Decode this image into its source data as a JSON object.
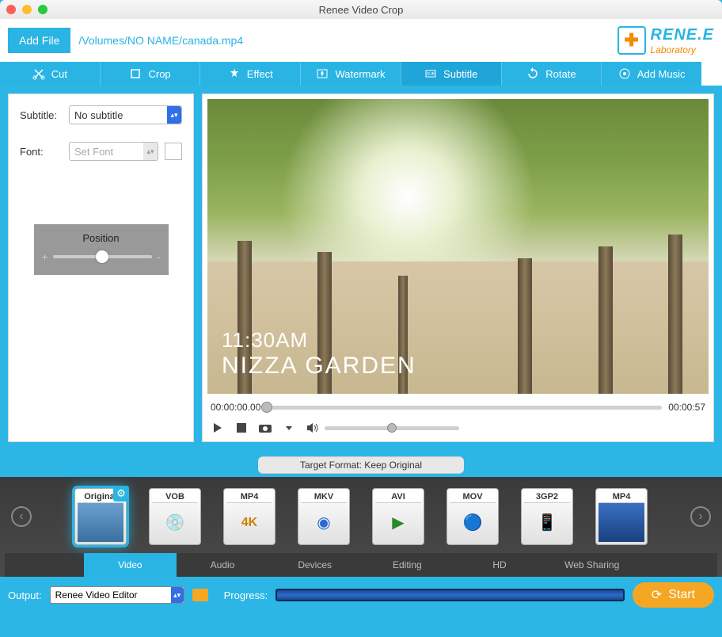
{
  "window": {
    "title": "Renee Video Crop"
  },
  "header": {
    "add_file_label": "Add File",
    "file_path": "/Volumes/NO NAME/canada.mp4",
    "brand_name": "RENE.E",
    "brand_sub": "Laboratory"
  },
  "tools": [
    {
      "label": "Cut",
      "icon": "cut-icon"
    },
    {
      "label": "Crop",
      "icon": "crop-icon"
    },
    {
      "label": "Effect",
      "icon": "effect-icon"
    },
    {
      "label": "Watermark",
      "icon": "watermark-icon"
    },
    {
      "label": "Subtitle",
      "icon": "subtitle-icon",
      "active": true
    },
    {
      "label": "Rotate",
      "icon": "rotate-icon"
    },
    {
      "label": "Add Music",
      "icon": "music-icon"
    }
  ],
  "subtitle_panel": {
    "subtitle_label": "Subtitle:",
    "subtitle_value": "No subtitle",
    "font_label": "Font:",
    "font_placeholder": "Set Font",
    "position_label": "Position"
  },
  "preview": {
    "overlay_line1": "11:30AM",
    "overlay_line2": "NIZZA GARDEN",
    "time_start": "00:00:00.00",
    "time_end": "00:00:57"
  },
  "target_format_label": "Target Format: Keep Original",
  "formats": [
    {
      "label": "Original",
      "selected": true
    },
    {
      "label": "VOB"
    },
    {
      "label": "MP4"
    },
    {
      "label": "MKV"
    },
    {
      "label": "AVI"
    },
    {
      "label": "MOV"
    },
    {
      "label": "3GP2"
    },
    {
      "label": "MP4"
    }
  ],
  "categories": [
    {
      "label": "Video",
      "active": true
    },
    {
      "label": "Audio"
    },
    {
      "label": "Devices"
    },
    {
      "label": "Editing"
    },
    {
      "label": "HD"
    },
    {
      "label": "Web Sharing"
    }
  ],
  "bottom": {
    "output_label": "Output:",
    "output_value": "Renee Video Editor",
    "progress_label": "Progress:",
    "start_label": "Start"
  }
}
